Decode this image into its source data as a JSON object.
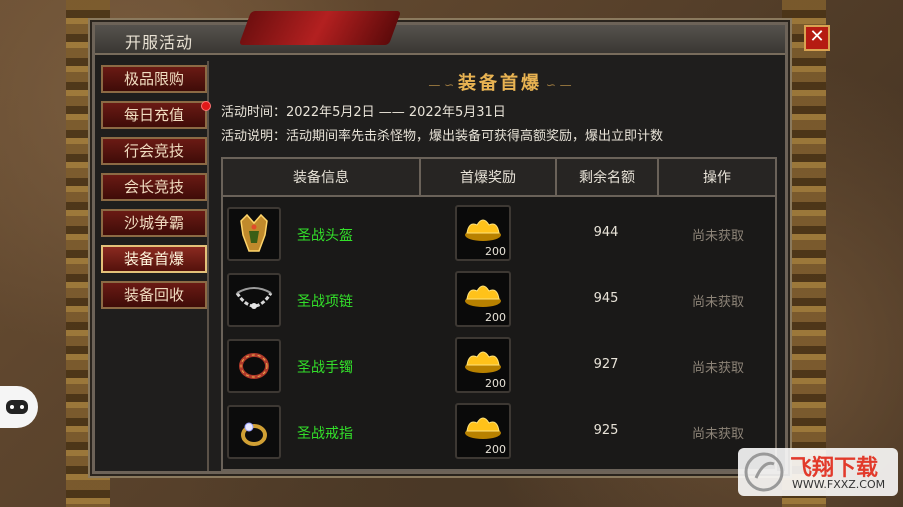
{
  "window": {
    "title": "开服活动",
    "close_label": "✕"
  },
  "sidebar": {
    "items": [
      {
        "label": "极品限购",
        "active": false,
        "badge": false
      },
      {
        "label": "每日充值",
        "active": false,
        "badge": true
      },
      {
        "label": "行会竞技",
        "active": false,
        "badge": false
      },
      {
        "label": "会长竞技",
        "active": false,
        "badge": false
      },
      {
        "label": "沙城争霸",
        "active": false,
        "badge": false
      },
      {
        "label": "装备首爆",
        "active": true,
        "badge": false
      },
      {
        "label": "装备回收",
        "active": false,
        "badge": false
      }
    ]
  },
  "main": {
    "title": "装备首爆",
    "title_deco_left": "— ∽ ",
    "title_deco_right": " ∽ —",
    "time_label": "活动时间：2022年5月2日 —— 2022年5月31日",
    "desc_label": "活动说明：活动期间率先击杀怪物，爆出装备可获得高额奖励，爆出立即计数",
    "table": {
      "headers": [
        "装备信息",
        "首爆奖励",
        "剩余名额",
        "操作"
      ],
      "rows": [
        {
          "name": "圣战头盔",
          "icon": "helmet-icon",
          "reward_icon": "gold-ingot-icon",
          "reward_count": "200",
          "remaining": "944",
          "action": "尚未获取"
        },
        {
          "name": "圣战项链",
          "icon": "necklace-icon",
          "reward_icon": "gold-ingot-icon",
          "reward_count": "200",
          "remaining": "945",
          "action": "尚未获取"
        },
        {
          "name": "圣战手镯",
          "icon": "bracelet-icon",
          "reward_icon": "gold-ingot-icon",
          "reward_count": "200",
          "remaining": "927",
          "action": "尚未获取"
        },
        {
          "name": "圣战戒指",
          "icon": "ring-icon",
          "reward_icon": "gold-ingot-icon",
          "reward_count": "200",
          "remaining": "925",
          "action": "尚未获取"
        }
      ]
    }
  },
  "watermark": {
    "brand": "飞翔下载",
    "url": "WWW.FXXZ.COM"
  },
  "colors": {
    "accent_gold": "#e8b352",
    "item_green": "#33e02a",
    "close_red": "#b51b12"
  }
}
